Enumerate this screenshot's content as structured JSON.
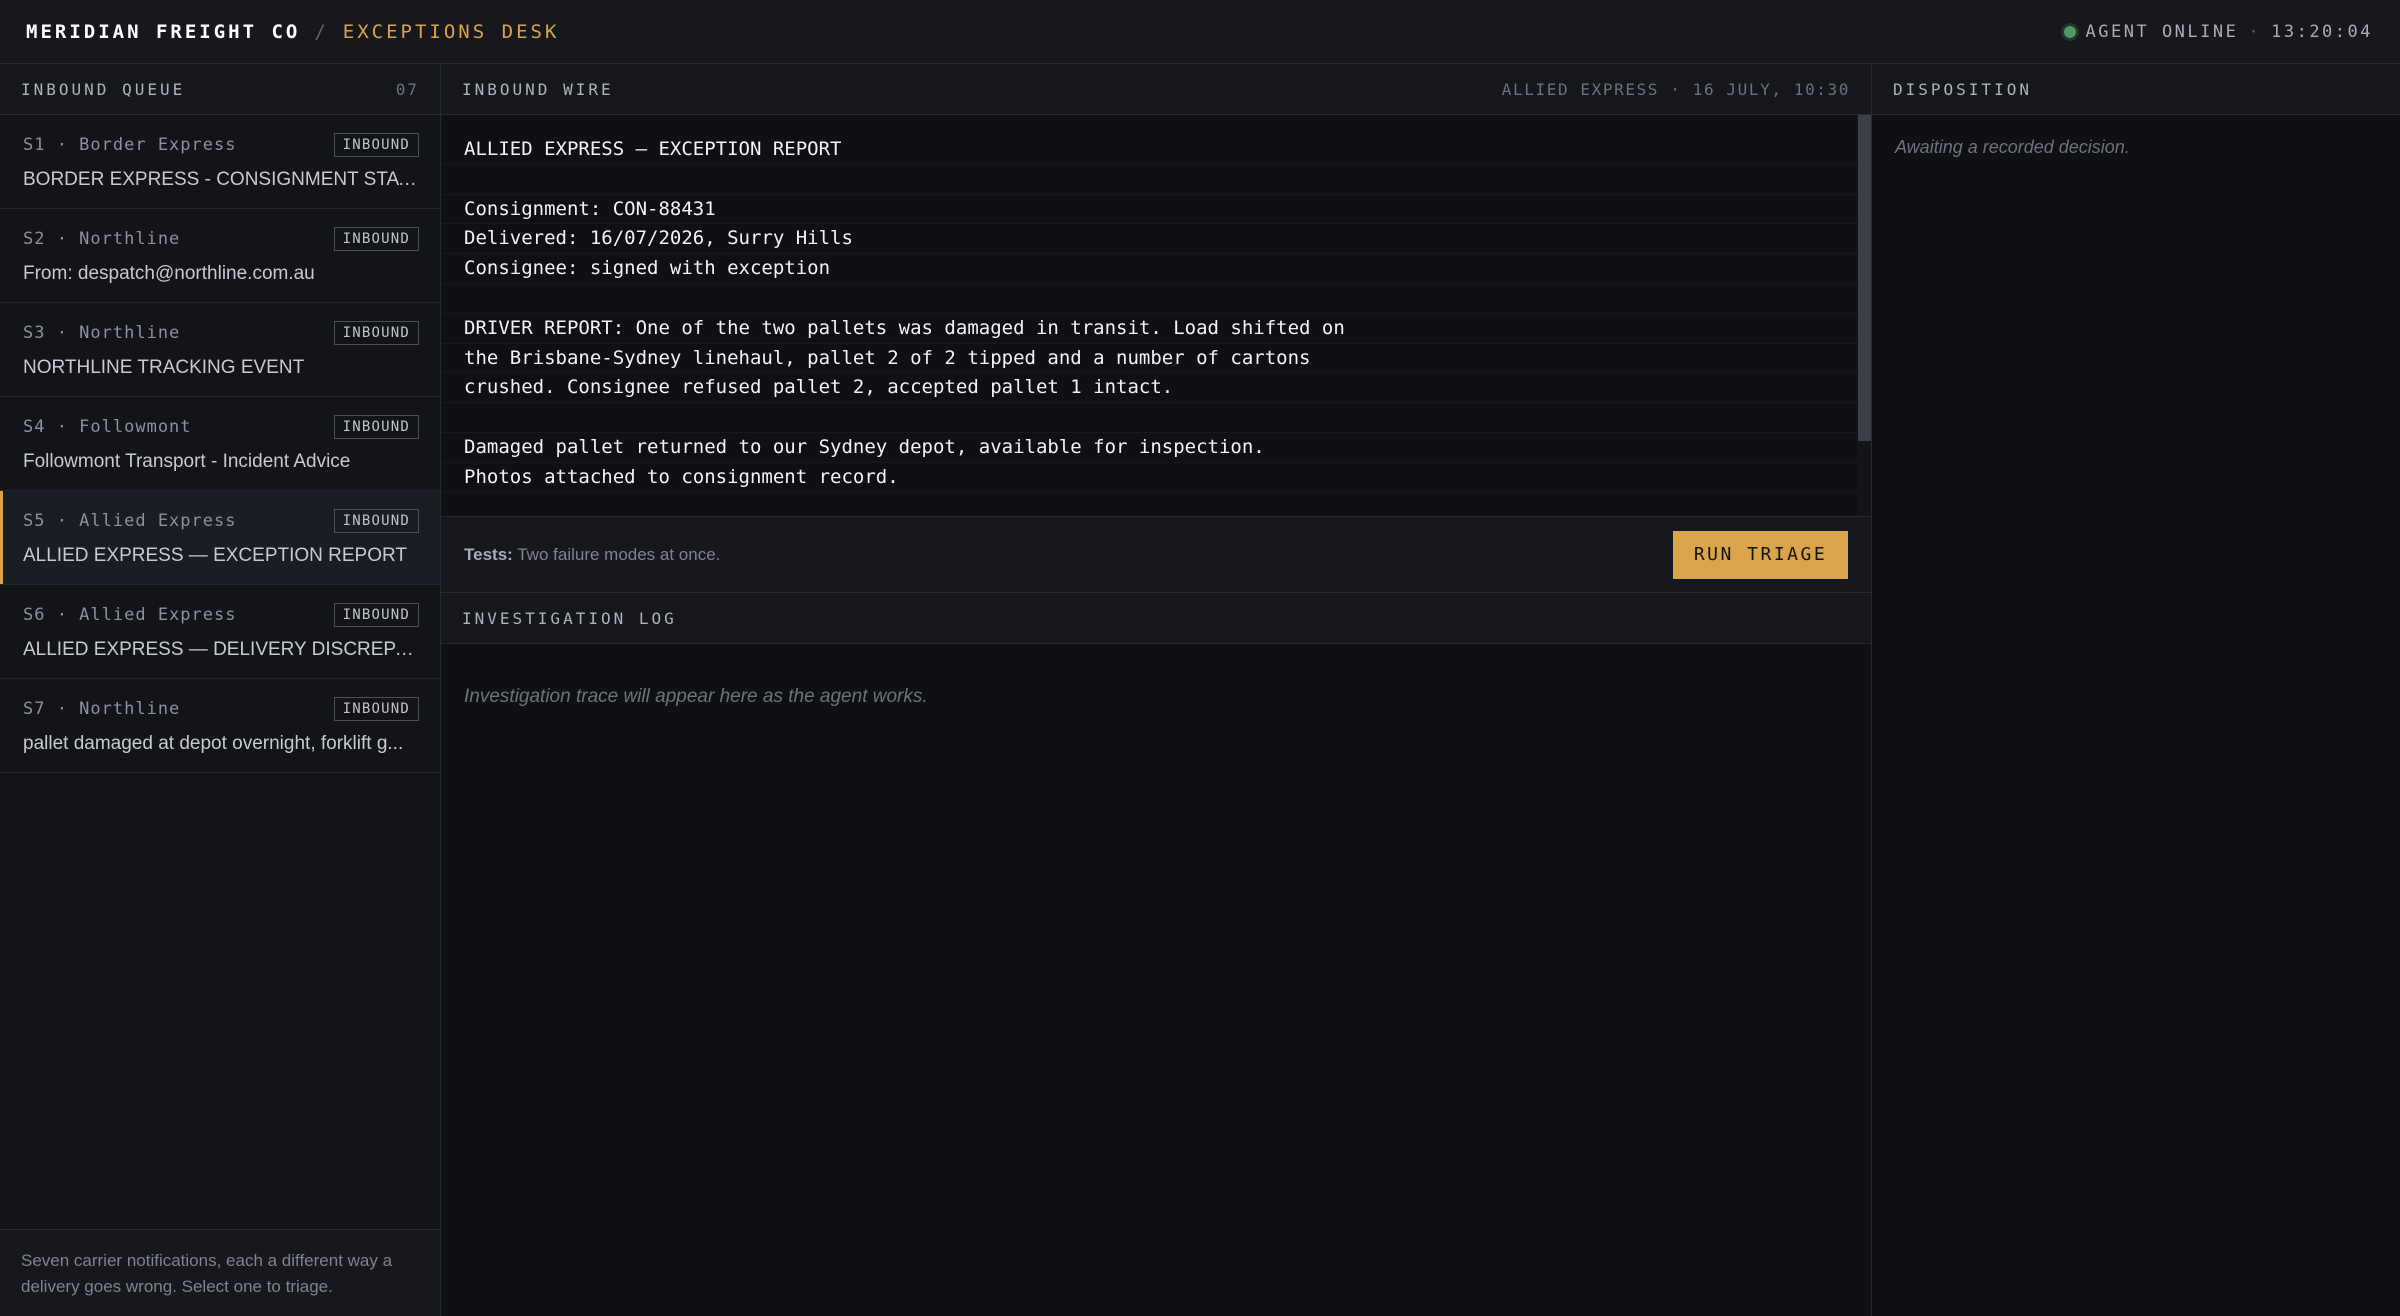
{
  "header": {
    "company": "MERIDIAN FREIGHT CO",
    "separator": "/",
    "desk": "EXCEPTIONS DESK",
    "status": "AGENT ONLINE",
    "status_sep": "·",
    "time": "13:20:04"
  },
  "queue": {
    "title": "INBOUND QUEUE",
    "count": "07",
    "items": [
      {
        "source": "S1 · Border Express",
        "badge": "INBOUND",
        "subject": "BORDER EXPRESS - CONSIGNMENT STATUS UPDATE"
      },
      {
        "source": "S2 · Northline",
        "badge": "INBOUND",
        "subject": "From: despatch@northline.com.au"
      },
      {
        "source": "S3 · Northline",
        "badge": "INBOUND",
        "subject": "NORTHLINE TRACKING EVENT"
      },
      {
        "source": "S4 · Followmont",
        "badge": "INBOUND",
        "subject": "Followmont Transport - Incident Advice"
      },
      {
        "source": "S5 · Allied Express",
        "badge": "INBOUND",
        "subject": "ALLIED EXPRESS — EXCEPTION REPORT"
      },
      {
        "source": "S6 · Allied Express",
        "badge": "INBOUND",
        "subject": "ALLIED EXPRESS — DELIVERY DISCREPANCY"
      },
      {
        "source": "S7 · Northline",
        "badge": "INBOUND",
        "subject": "pallet damaged at depot overnight, forklift g..."
      }
    ],
    "footer": "Seven carrier notifications, each a different way a delivery goes wrong. Select one to triage."
  },
  "wire": {
    "title": "INBOUND WIRE",
    "meta": "ALLIED EXPRESS · 16 JULY, 10:30",
    "lines": [
      "ALLIED EXPRESS — EXCEPTION REPORT",
      "",
      "Consignment: CON-88431",
      "Delivered: 16/07/2026, Surry Hills",
      "Consignee: signed with exception",
      "",
      "DRIVER REPORT: One of the two pallets was damaged in transit. Load shifted on",
      "the Brisbane-Sydney linehaul, pallet 2 of 2 tipped and a number of cartons",
      "crushed. Consignee refused pallet 2, accepted pallet 1 intact.",
      "",
      "Damaged pallet returned to our Sydney depot, available for inspection.",
      "Photos attached to consignment record."
    ]
  },
  "action": {
    "tests_label": "Tests:",
    "tests_text": "Two failure modes at once.",
    "run_label": "RUN TRIAGE"
  },
  "log": {
    "title": "INVESTIGATION LOG",
    "placeholder": "Investigation trace will appear here as the agent works."
  },
  "disposition": {
    "title": "DISPOSITION",
    "placeholder": "Awaiting a recorded decision."
  },
  "colors": {
    "accent": "#d9a44b",
    "online": "#4f9a63",
    "background": "#0e1014"
  },
  "active_item": 4
}
